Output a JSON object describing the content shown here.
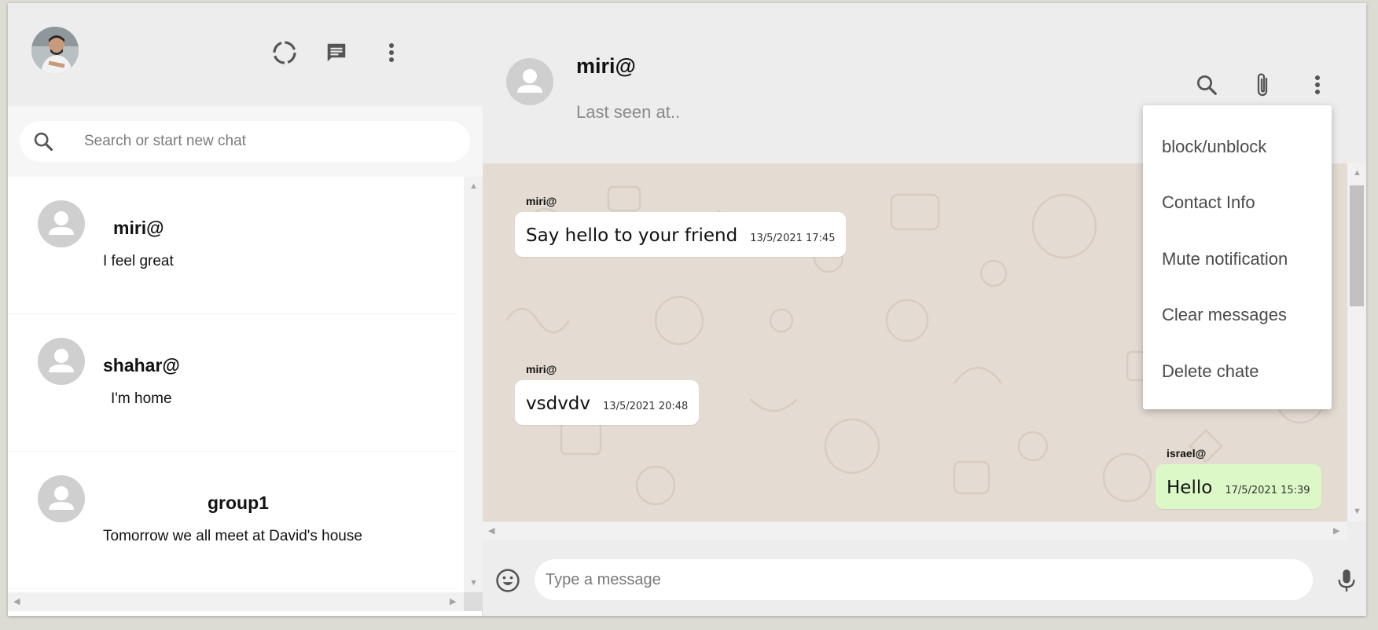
{
  "sidebar": {
    "header": {
      "status_icon": "status-ring-icon",
      "new_chat_icon": "chat-bubble-icon",
      "menu_icon": "more-vertical-icon"
    },
    "search": {
      "placeholder": "Search or start new chat"
    },
    "chats": [
      {
        "name": "miri@",
        "last_message": "I feel great"
      },
      {
        "name": "shahar@",
        "last_message": "I'm home"
      },
      {
        "name": "group1",
        "last_message": "Tomorrow we all meet at David's house"
      }
    ]
  },
  "conversation": {
    "contact_name": "miri@",
    "contact_status": "Last seen at..",
    "messages": [
      {
        "sender": "miri@",
        "text": "Say hello to your friend",
        "time": "13/5/2021 17:45",
        "direction": "in"
      },
      {
        "sender": "miri@",
        "text": "vsdvdv",
        "time": "13/5/2021 20:48",
        "direction": "in"
      },
      {
        "sender": "israel@",
        "text": "Hello",
        "time": "17/5/2021 15:39",
        "direction": "out"
      }
    ],
    "composer": {
      "placeholder": "Type a message"
    }
  },
  "menu": {
    "items": [
      "block/unblock",
      "Contact Info",
      "Mute notification",
      "Clear messages",
      "Delete chate"
    ]
  },
  "colors": {
    "outgoing_bubble": "#dcf8c6",
    "incoming_bubble": "#ffffff",
    "chat_background": "#e4dcd3",
    "header_background": "#ededed"
  }
}
